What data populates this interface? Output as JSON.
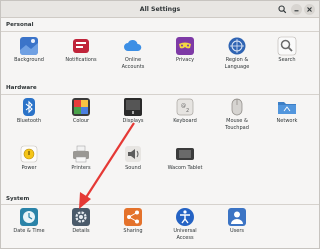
{
  "window": {
    "title": "All Settings"
  },
  "sections": {
    "personal": {
      "label": "Personal",
      "items": [
        {
          "label": "Background",
          "icon": "background-icon"
        },
        {
          "label": "Notifications",
          "icon": "notifications-icon"
        },
        {
          "label": "Online\nAccounts",
          "icon": "online-accounts-icon"
        },
        {
          "label": "Privacy",
          "icon": "privacy-icon"
        },
        {
          "label": "Region &\nLanguage",
          "icon": "region-language-icon"
        },
        {
          "label": "Search",
          "icon": "search-icon"
        }
      ]
    },
    "hardware": {
      "label": "Hardware",
      "items": [
        {
          "label": "Bluetooth",
          "icon": "bluetooth-icon"
        },
        {
          "label": "Colour",
          "icon": "colour-icon"
        },
        {
          "label": "Displays",
          "icon": "displays-icon"
        },
        {
          "label": "Keyboard",
          "icon": "keyboard-icon"
        },
        {
          "label": "Mouse &\nTouchpad",
          "icon": "mouse-icon"
        },
        {
          "label": "Network",
          "icon": "network-icon"
        },
        {
          "label": "Power",
          "icon": "power-icon"
        },
        {
          "label": "Printers",
          "icon": "printers-icon"
        },
        {
          "label": "Sound",
          "icon": "sound-icon"
        },
        {
          "label": "Wacom Tablet",
          "icon": "wacom-tablet-icon"
        }
      ]
    },
    "system": {
      "label": "System",
      "items": [
        {
          "label": "Date & Time",
          "icon": "date-time-icon"
        },
        {
          "label": "Details",
          "icon": "details-icon"
        },
        {
          "label": "Sharing",
          "icon": "sharing-icon"
        },
        {
          "label": "Universal\nAccess",
          "icon": "universal-access-icon"
        },
        {
          "label": "Users",
          "icon": "users-icon"
        }
      ]
    }
  },
  "colors": {
    "annotation_arrow": "#e53935",
    "accent": "#3584e4"
  }
}
